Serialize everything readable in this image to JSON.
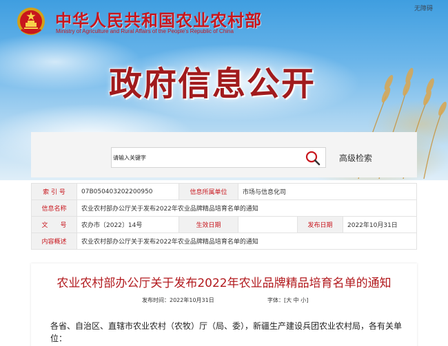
{
  "header": {
    "ministry_cn": "中华人民共和国农业农村部",
    "ministry_en": "Ministry of Agriculture and Rural Affairs of the People's Republic of China",
    "accessibility": "无障碍",
    "hero_title": "政府信息公开"
  },
  "search": {
    "placeholder": "请输入关键字",
    "advanced": "高级检索"
  },
  "meta": {
    "index_label": "索 引 号",
    "index_value": "07B050403202200950",
    "unit_label": "信息所属单位",
    "unit_value": "市场与信息化司",
    "name_label": "信息名称",
    "name_value": "农业农村部办公厅关于发布2022年农业品牌精品培育名单的通知",
    "doc_label": "文　　号",
    "doc_value": "农办市〔2022〕14号",
    "effective_label": "生效日期",
    "effective_value": "",
    "publish_label": "发布日期",
    "publish_value": "2022年10月31日",
    "summary_label": "内容概述",
    "summary_value": "农业农村部办公厅关于发布2022年农业品牌精品培育名单的通知"
  },
  "article": {
    "title": "农业农村部办公厅关于发布2022年农业品牌精品培育名单的通知",
    "publish_time": "发布时间：2022年10月31日",
    "font_size_label": "字体：",
    "font_size_ctrl": "[大 中 小]",
    "body": "各省、自治区、直辖市农业农村（农牧）厅（局、委），新疆生产建设兵团农业农村局，各有关单位："
  },
  "colors": {
    "accent_red": "#c8161d",
    "title_red": "#b21a1e",
    "sky_blue": "#3f9ee0"
  },
  "icons": {
    "emblem": "national-emblem",
    "search": "search-icon"
  }
}
